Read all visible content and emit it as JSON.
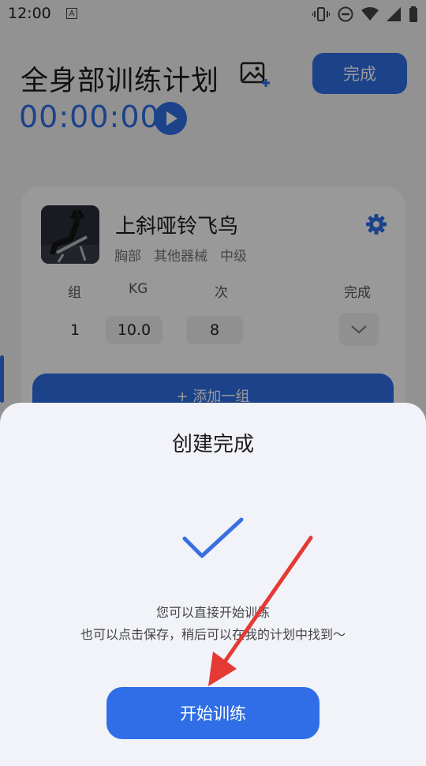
{
  "status_bar": {
    "time": "12:00",
    "a_icon": "A"
  },
  "header": {
    "title": "全身部训练计划",
    "done_label": "完成",
    "timer": "00:00:00"
  },
  "exercise": {
    "name": "上斜哑铃飞鸟",
    "tags": [
      "胸部",
      "其他器械",
      "中级"
    ],
    "columns": {
      "set": "组",
      "kg": "KG",
      "reps": "次",
      "done": "完成"
    },
    "rows": [
      {
        "set": "1",
        "kg": "10.0",
        "reps": "8"
      }
    ],
    "add_set_label": "+ 添加一组"
  },
  "dialog": {
    "title": "创建完成",
    "line1": "您可以直接开始训练",
    "line2": "也可以点击保存，稍后可以在我的计划中找到～",
    "start_label": "开始训练"
  },
  "colors": {
    "accent": "#2f6ee6",
    "arrow": "#e53935"
  }
}
